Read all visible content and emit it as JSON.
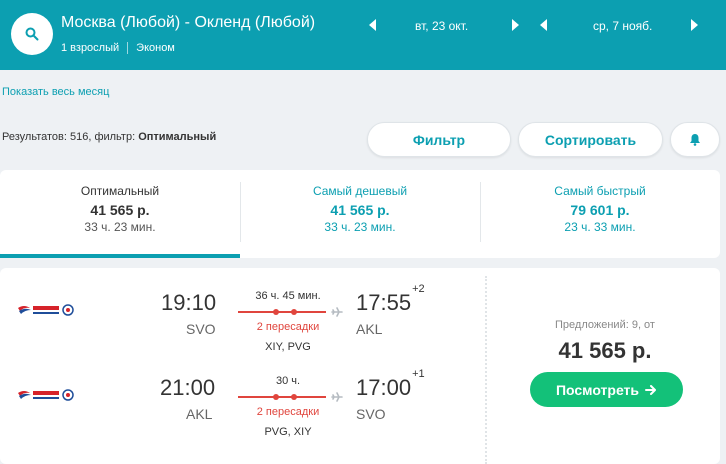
{
  "header": {
    "route": "Москва (Любой) - Окленд (Любой)",
    "passengers": "1 взрослый",
    "cabin": "Эконом",
    "depart_date": "вт, 23 окт.",
    "return_date": "ср, 7 нояб."
  },
  "month_link": "Показать весь месяц",
  "results": {
    "prefix": "Результатов: 516, фильтр: ",
    "filter_name": "Оптимальный"
  },
  "buttons": {
    "filter": "Фильтр",
    "sort": "Сортировать"
  },
  "tabs": [
    {
      "title": "Оптимальный",
      "price": "41 565 р.",
      "duration": "33 ч. 23 мин."
    },
    {
      "title": "Самый дешевый",
      "price": "41 565 р.",
      "duration": "33 ч. 23 мин."
    },
    {
      "title": "Самый быстрый",
      "price": "79 601 р.",
      "duration": "23 ч. 33 мин."
    }
  ],
  "flights": [
    {
      "dep_time": "19:10",
      "dep_code": "SVO",
      "duration": "36 ч. 45 мин.",
      "stops": "2 пересадки",
      "via": "XIY, PVG",
      "arr_time": "17:55",
      "day_offset": "+2",
      "arr_code": "AKL"
    },
    {
      "dep_time": "21:00",
      "dep_code": "AKL",
      "duration": "30 ч.",
      "stops": "2 пересадки",
      "via": "PVG, XIY",
      "arr_time": "17:00",
      "day_offset": "+1",
      "arr_code": "SVO"
    }
  ],
  "offer": {
    "offers_text": "Предложений: 9, от",
    "price": "41 565 р.",
    "button": "Посмотреть"
  },
  "colors": {
    "header": "#0c9fb1",
    "accent": "#0c9fb1",
    "stops": "#e0453d",
    "buy": "#13c179"
  }
}
